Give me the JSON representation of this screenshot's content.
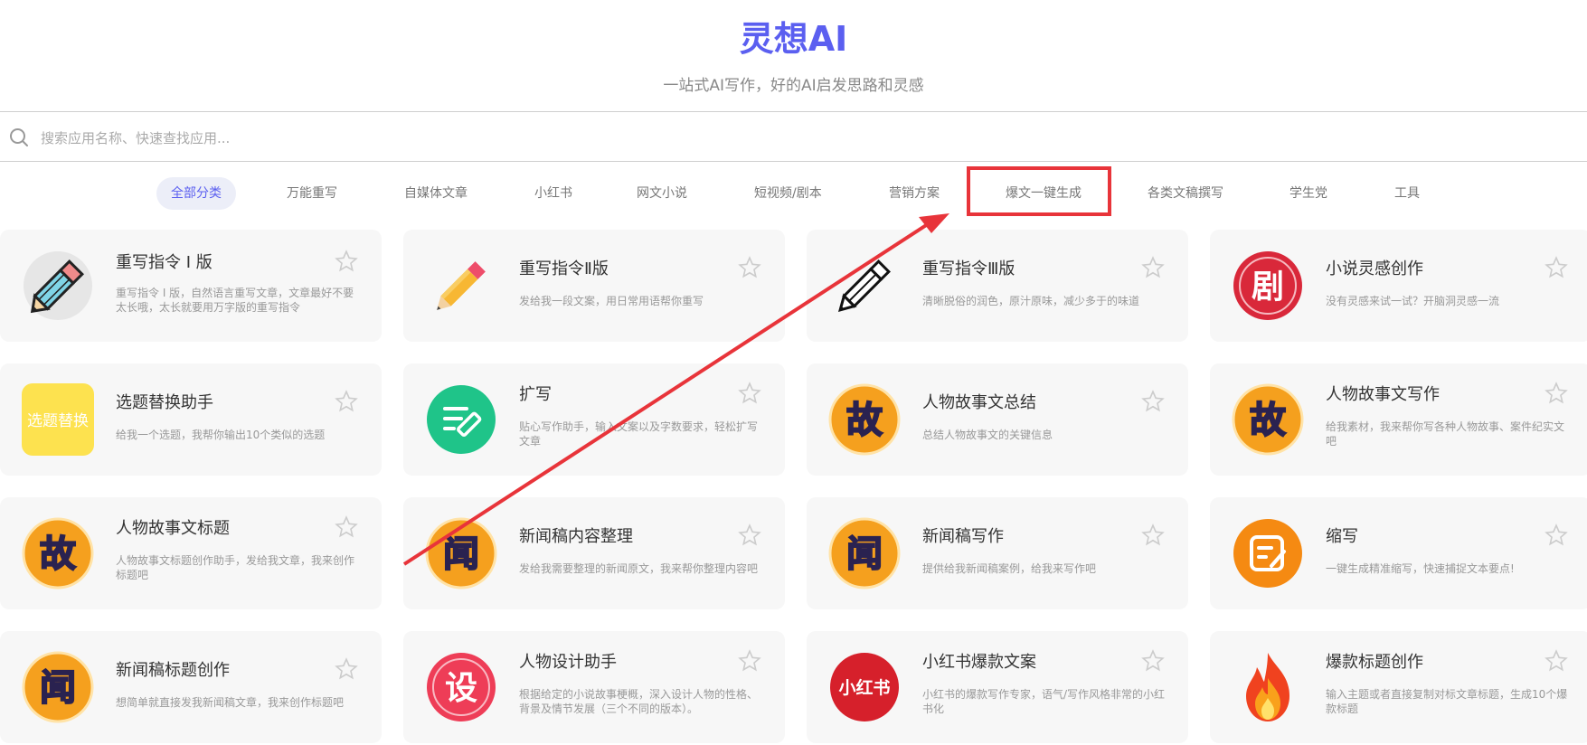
{
  "header": {
    "title": "灵想AI",
    "subtitle": "一站式AI写作，好的AI启发思路和灵感"
  },
  "search": {
    "placeholder": "搜索应用名称、快速查找应用...",
    "icon": "search-icon"
  },
  "tabs": [
    {
      "label": "全部分类",
      "active": true
    },
    {
      "label": "万能重写"
    },
    {
      "label": "自媒体文章"
    },
    {
      "label": "小红书"
    },
    {
      "label": "网文小说"
    },
    {
      "label": "短视频/剧本"
    },
    {
      "label": "营销方案"
    },
    {
      "label": "爆文一键生成"
    },
    {
      "label": "各类文稿撰写"
    },
    {
      "label": "学生党"
    },
    {
      "label": "工具"
    }
  ],
  "annotation": {
    "highlight_color": "#e8343a",
    "highlighted_tab": "爆文一键生成"
  },
  "accent_color": "#5b5ff0",
  "cards": [
    {
      "title": "重写指令 I 版",
      "desc": "重写指令 I 版，自然语言重写文章，文章最好不要太长哦，太长就要用万字版的重写指令",
      "icon": "pencil-blue-icon"
    },
    {
      "title": "重写指令Ⅱ版",
      "desc": "发给我一段文案，用日常用语帮你重写",
      "icon": "pencil-yellow-icon"
    },
    {
      "title": "重写指令Ⅲ版",
      "desc": "清晰脱俗的润色，原汁原味，减少多于的味道",
      "icon": "pencil-outline-icon"
    },
    {
      "title": "小说灵感创作",
      "desc": "没有灵感来试一试？开脑洞灵感一流",
      "icon": "ju-badge-icon",
      "glyph": "剧"
    },
    {
      "title": "选题替换助手",
      "desc": "给我一个选题，我帮你输出10个类似的选题",
      "icon": "topic-replace-icon",
      "glyph": "选题替换"
    },
    {
      "title": "扩写",
      "desc": "贴心写作助手，输入文案以及字数要求，轻松扩写文章",
      "icon": "edit-green-icon"
    },
    {
      "title": "人物故事文总结",
      "desc": "总结人物故事文的关键信息",
      "icon": "gu-badge-icon",
      "glyph": "故"
    },
    {
      "title": "人物故事文写作",
      "desc": "给我素材，我来帮你写各种人物故事、案件纪实文吧",
      "icon": "gu-badge-icon",
      "glyph": "故"
    },
    {
      "title": "人物故事文标题",
      "desc": "人物故事文标题创作助手，发给我文章，我来创作标题吧",
      "icon": "gu-badge-icon",
      "glyph": "故"
    },
    {
      "title": "新闻稿内容整理",
      "desc": "发给我需要整理的新闻原文，我来帮你整理内容吧",
      "icon": "wen-badge-icon",
      "glyph": "闻"
    },
    {
      "title": "新闻稿写作",
      "desc": "提供给我新闻稿案例，给我来写作吧",
      "icon": "wen-badge-icon",
      "glyph": "闻"
    },
    {
      "title": "缩写",
      "desc": "一键生成精准缩写，快速捕捉文本要点!",
      "icon": "shrink-edit-icon"
    },
    {
      "title": "新闻稿标题创作",
      "desc": "想简单就直接发我新闻稿文章，我来创作标题吧",
      "icon": "wen-badge-icon",
      "glyph": "闻"
    },
    {
      "title": "人物设计助手",
      "desc": "根据给定的小说故事梗概，深入设计人物的性格、背景及情节发展（三个不同的版本）。",
      "icon": "she-badge-icon",
      "glyph": "设"
    },
    {
      "title": "小红书爆款文案",
      "desc": "小红书的爆款写作专家，语气/写作风格非常的小红书化",
      "icon": "xiaohongshu-icon",
      "glyph": "小红书"
    },
    {
      "title": "爆款标题创作",
      "desc": "输入主题或者直接复制对标文章标题，生成10个爆款标题",
      "icon": "fire-icon"
    }
  ]
}
